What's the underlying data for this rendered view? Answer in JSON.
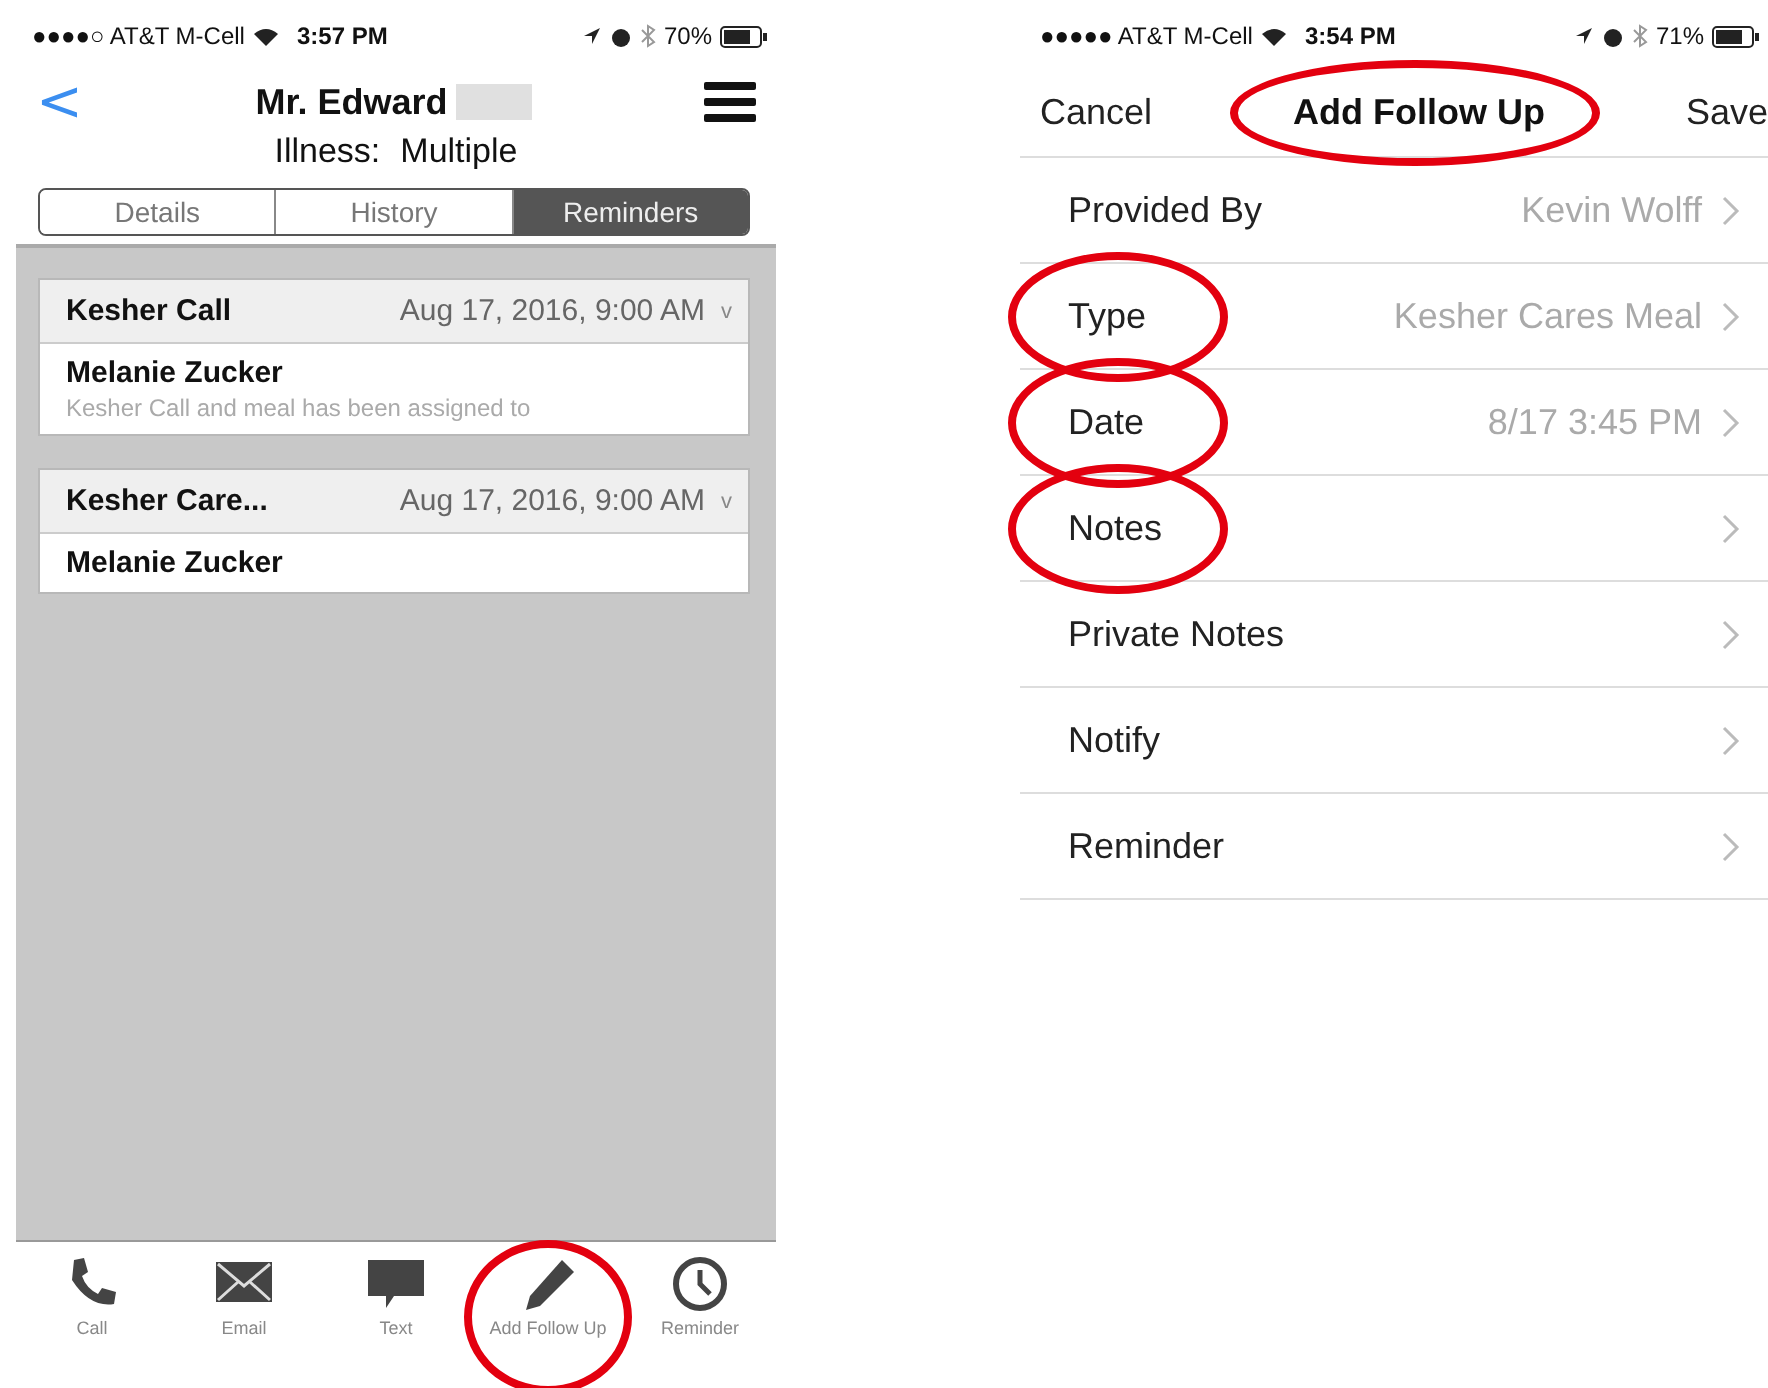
{
  "left_screen": {
    "status_bar": {
      "carrier": "●●●●○ AT&T M-Cell",
      "time": "3:57 PM",
      "battery": "70%"
    },
    "nav": {
      "back": "<",
      "title": "Mr. Edward",
      "name_redacted": true,
      "subtitle_label": "Illness:",
      "subtitle_value": "Multiple"
    },
    "tabs": [
      {
        "label": "Details",
        "selected": false
      },
      {
        "label": "History",
        "selected": false
      },
      {
        "label": "Reminders",
        "selected": true
      }
    ],
    "reminders": [
      {
        "title": "Kesher Call",
        "date": "Aug 17, 2016, 9:00 AM",
        "chevron": "v",
        "person": "Melanie Zucker",
        "note": "Kesher Call and meal has been assigned to"
      },
      {
        "title": "Kesher Care...",
        "date": "Aug 17, 2016, 9:00 AM",
        "chevron": "v",
        "person": "Melanie Zucker"
      }
    ],
    "toolbar": [
      {
        "kind": "phone",
        "label": "Call",
        "circled": false
      },
      {
        "kind": "mail",
        "label": "Email",
        "circled": false
      },
      {
        "kind": "bubble",
        "label": "Text",
        "circled": false
      },
      {
        "kind": "pencil",
        "label": "Add Follow Up",
        "circled": true
      },
      {
        "kind": "clock",
        "label": "Reminder",
        "circled": false
      }
    ]
  },
  "right_screen": {
    "status_bar": {
      "carrier": "●●●●● AT&T M-Cell",
      "time": "3:54 PM",
      "battery": "71%"
    },
    "nav": {
      "cancel": "Cancel",
      "title": "Add Follow Up",
      "title_circled": true,
      "save": "Save"
    },
    "rows": [
      {
        "label": "Provided By",
        "value": "Kevin Wolff",
        "circled": false
      },
      {
        "label": "Type",
        "value": "Kesher Cares Meal",
        "circled": true
      },
      {
        "label": "Date",
        "value": "8/17 3:45 PM",
        "circled": true
      },
      {
        "label": "Notes",
        "circled": true
      },
      {
        "label": "Private Notes",
        "circled": false
      },
      {
        "label": "Notify",
        "circled": false
      },
      {
        "label": "Reminder",
        "circled": false
      }
    ]
  }
}
